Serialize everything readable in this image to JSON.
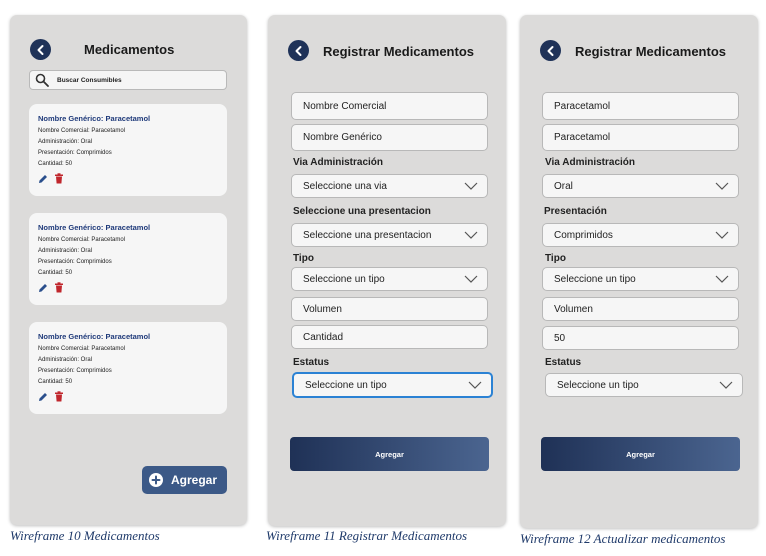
{
  "screen1": {
    "title": "Medicamentos",
    "search_placeholder": "Buscar Consumibles",
    "cards": [
      {
        "title": "Nombre Genérico: Paracetamol",
        "comercial": "Nombre Comercial: Paracetamol",
        "administracion": "Administración: Oral",
        "presentacion": "Presentación: Comprimidos",
        "cantidad": "Cantidad: 50"
      },
      {
        "title": "Nombre Genérico: Paracetamol",
        "comercial": "Nombre Comercial: Paracetamol",
        "administracion": "Administración: Oral",
        "presentacion": "Presentación: Comprimidos",
        "cantidad": "Cantidad: 50"
      },
      {
        "title": "Nombre Genérico: Paracetamol",
        "comercial": "Nombre Comercial: Paracetamol",
        "administracion": "Administración: Oral",
        "presentacion": "Presentación: Comprimidos",
        "cantidad": "Cantidad: 50"
      }
    ],
    "add_button": "Agregar",
    "caption": "Wireframe 10 Medicamentos"
  },
  "screen2": {
    "title": "Registrar Medicamentos",
    "nombre_comercial": "Nombre Comercial",
    "nombre_generico": "Nombre Genérico",
    "via_label": "Via Administración",
    "via_select": "Seleccione una via",
    "presentacion_label": "Seleccione una presentacion",
    "presentacion_select": "Seleccione una presentacion",
    "tipo_label": "Tipo",
    "tipo_select": "Seleccione un tipo",
    "volumen": "Volumen",
    "cantidad": "Cantidad",
    "estatus_label": "Estatus",
    "estatus_select": "Seleccione un tipo",
    "submit": "Agregar",
    "caption": "Wireframe 11 Registrar Medicamentos"
  },
  "screen3": {
    "title": "Registrar Medicamentos",
    "nombre_comercial": "Paracetamol",
    "nombre_generico": "Paracetamol",
    "via_label": "Via Administración",
    "via_select": "Oral",
    "presentacion_label": "Presentación",
    "presentacion_select": "Comprimidos",
    "tipo_label": "Tipo",
    "tipo_select": "Seleccione un tipo",
    "volumen": "Volumen",
    "cantidad": "50",
    "estatus_label": "Estatus",
    "estatus_select": "Seleccione un tipo",
    "submit": "Agregar",
    "caption": "Wireframe 12 Actualizar medicamentos"
  },
  "colors": {
    "accent": "#1f3258",
    "button_gradient_end": "#4b6590",
    "link_blue": "#1f3a7a",
    "delete_red": "#c0262c",
    "focus_blue": "#2b82d4"
  },
  "icons": [
    "chevron-left-icon",
    "search-icon",
    "pencil-icon",
    "trash-icon",
    "plus-icon",
    "chevron-down-icon"
  ]
}
